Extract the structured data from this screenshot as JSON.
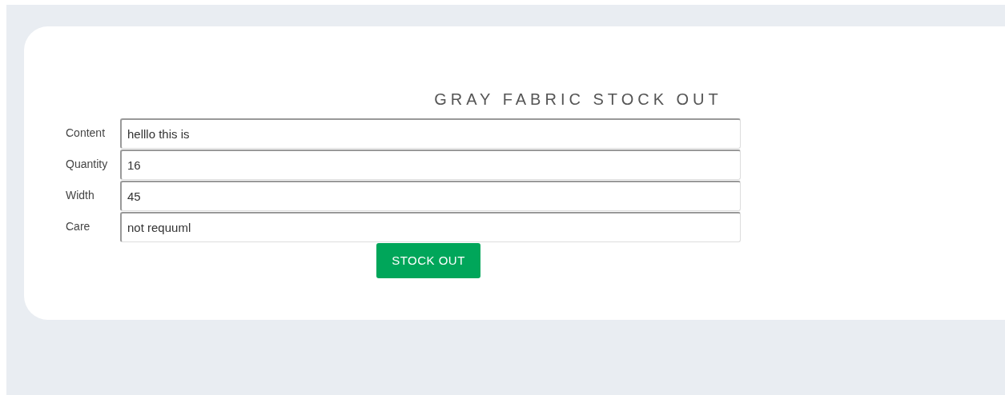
{
  "title": "GRAY FABRIC STOCK OUT",
  "fields": [
    {
      "label": "Content",
      "value": "helllo this is"
    },
    {
      "label": "Quantity",
      "value": "16"
    },
    {
      "label": "Width",
      "value": "45"
    },
    {
      "label": "Care",
      "value": "not requuml"
    }
  ],
  "button": "STOCK OUT"
}
